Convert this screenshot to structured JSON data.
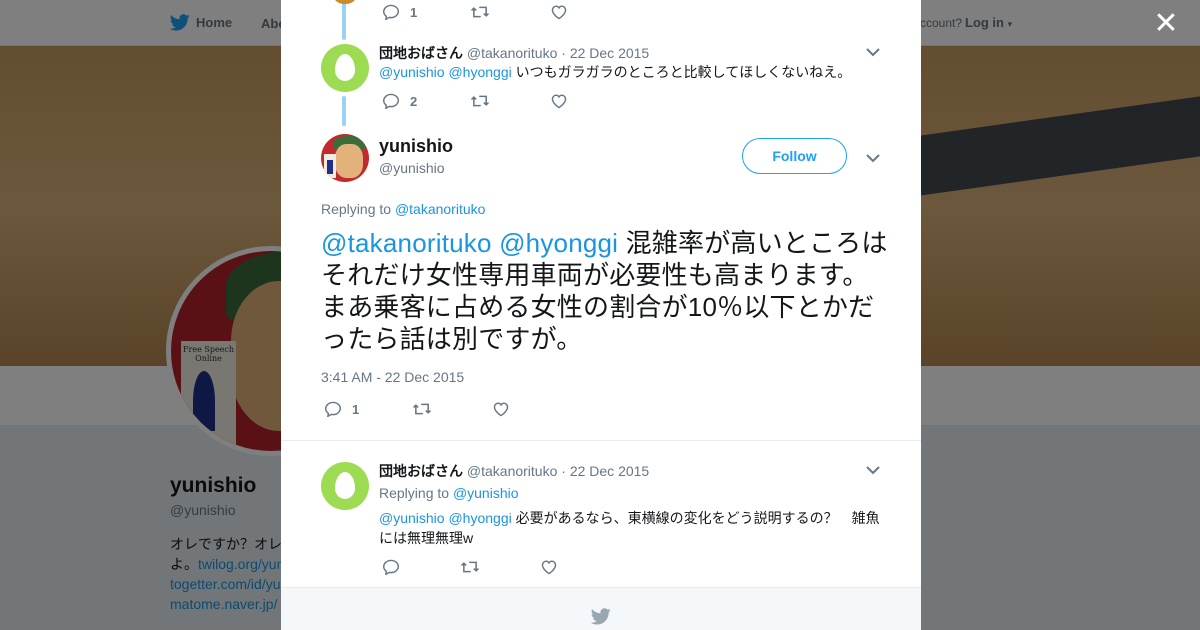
{
  "topbar": {
    "home_label": "Home",
    "about_label": "Abo",
    "have_account": "ccount?",
    "login_label": "Log in"
  },
  "profile": {
    "name": "yunishio",
    "handle": "@yunishio",
    "bio_line1": "オレですか？オレ",
    "bio_line2a": "よ。",
    "bio_link1": "twilog.org/yun",
    "bio_link2": "togetter.com/id/yu",
    "bio_link3": "matome.naver.jp/",
    "avatar_text": "Free Speech Online"
  },
  "modal": {
    "prev_tweet_actions": {
      "replies": "1",
      "retweets": "",
      "likes": ""
    },
    "reply1": {
      "display_name": "団地おばさん",
      "handle": "@takanorituko",
      "sep": "·",
      "date": "22 Dec 2015",
      "mention1": "@yunishio",
      "mention2": "@hyonggi",
      "text": "いつもガラガラのところと比較してほしくないねえ。",
      "replies": "2"
    },
    "main": {
      "display_name": "yunishio",
      "handle": "@yunishio",
      "follow_label": "Follow",
      "replying_label": "Replying to",
      "replying_handle": "@takanorituko",
      "mention1": "@takanorituko",
      "mention2": "@hyonggi",
      "text": "混雑率が高いところはそれだけ女性専用車両が必要性も高まります。まあ乗客に占める女性の割合が10％以下とかだったら話は別ですが。",
      "timestamp": "3:41 AM - 22 Dec 2015",
      "replies": "1"
    },
    "reply2": {
      "display_name": "団地おばさん",
      "handle": "@takanorituko",
      "sep": "·",
      "date": "22 Dec 2015",
      "replying_label": "Replying to",
      "replying_handle": "@yunishio",
      "mention1": "@yunishio",
      "mention2": "@hyonggi",
      "text": "必要があるなら、東横線の変化をどう説明するの？　雑魚には無理無理w"
    }
  },
  "colors": {
    "accent": "#1da1f2",
    "link": "#1b95e0",
    "thread_line": "#9bd1f5",
    "egg": "#9ddb52"
  },
  "icons": [
    "twitter-bird-icon",
    "close-icon",
    "reply-icon",
    "retweet-icon",
    "like-icon",
    "chevron-down-icon",
    "caret-down-icon"
  ]
}
